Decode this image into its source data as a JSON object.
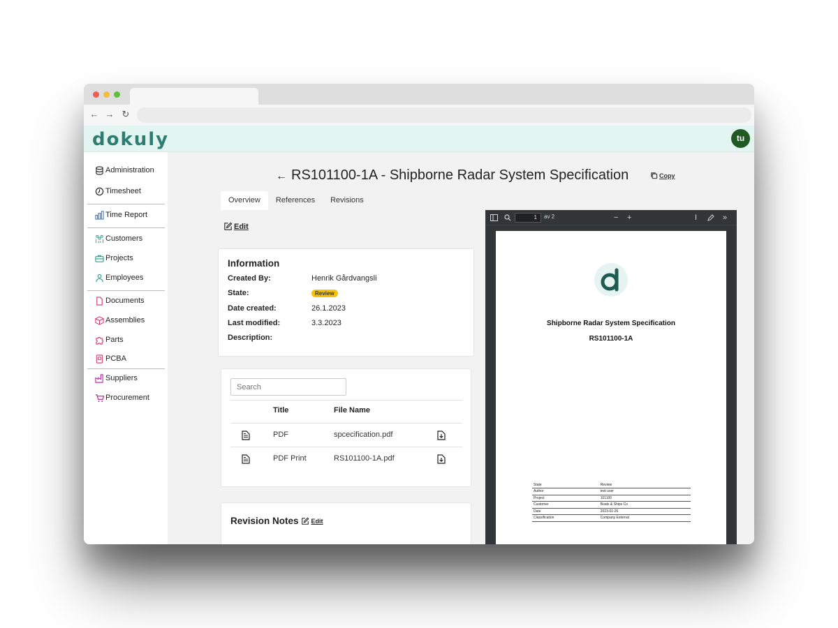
{
  "app": {
    "logo_text": "dokuly",
    "user_initials": "tu",
    "brand_color": "#2e7d72",
    "header_bg": "#e3f5f1"
  },
  "sidebar": {
    "items": [
      {
        "label": "Administration",
        "icon": "database-icon",
        "color": "#222222"
      },
      {
        "label": "Timesheet",
        "icon": "clock-icon",
        "color": "#222222"
      },
      {
        "label": "Time Report",
        "icon": "bar-chart-icon",
        "color": "#3b6fb5"
      },
      {
        "label": "Customers",
        "icon": "users-icon",
        "color": "#2a9d8f"
      },
      {
        "label": "Projects",
        "icon": "briefcase-icon",
        "color": "#2a9d8f"
      },
      {
        "label": "Employees",
        "icon": "user-icon",
        "color": "#2a9d8f"
      },
      {
        "label": "Documents",
        "icon": "document-icon",
        "color": "#d6336c"
      },
      {
        "label": "Assemblies",
        "icon": "assembly-icon",
        "color": "#d6336c"
      },
      {
        "label": "Parts",
        "icon": "puzzle-icon",
        "color": "#d6336c"
      },
      {
        "label": "PCBA",
        "icon": "pcb-icon",
        "color": "#d6336c"
      },
      {
        "label": "Suppliers",
        "icon": "factory-icon",
        "color": "#b5179e"
      },
      {
        "label": "Procurement",
        "icon": "cart-icon",
        "color": "#b5179e"
      }
    ]
  },
  "page": {
    "title": "RS101100-1A - Shipborne Radar System Specification",
    "copy_label": "Copy",
    "edit_label": "Edit"
  },
  "tabs": [
    {
      "label": "Overview",
      "active": true
    },
    {
      "label": "References",
      "active": false
    },
    {
      "label": "Revisions",
      "active": false
    }
  ],
  "information": {
    "title": "Information",
    "rows": [
      {
        "label": "Created By:",
        "value": "Henrik Gårdvangsli"
      },
      {
        "label": "State:",
        "value": "Review"
      },
      {
        "label": "Date created:",
        "value": "26.1.2023"
      },
      {
        "label": "Last modified:",
        "value": "3.3.2023"
      },
      {
        "label": "Description:",
        "value": ""
      }
    ]
  },
  "files": {
    "search_placeholder": "Search",
    "columns": [
      "Title",
      "File Name"
    ],
    "rows": [
      {
        "title": "PDF",
        "file_name": "spcecification.pdf"
      },
      {
        "title": "PDF Print",
        "file_name": "RS101100-1A.pdf"
      }
    ]
  },
  "revision_notes": {
    "title": "Revision Notes",
    "edit_label": "Edit"
  },
  "pdf": {
    "current_page": "1",
    "page_total": "av 2",
    "doc_title": "Shipborne Radar System Specification",
    "doc_number": "RS101100-1A",
    "meta": [
      {
        "key": "State",
        "value": "Review"
      },
      {
        "key": "Author",
        "value": "test user"
      },
      {
        "key": "Project",
        "value": "101100"
      },
      {
        "key": "Customer",
        "value": "Boats & Ships Co"
      },
      {
        "key": "Date",
        "value": "2023-01-26"
      },
      {
        "key": "Classification",
        "value": "Company External"
      }
    ]
  }
}
